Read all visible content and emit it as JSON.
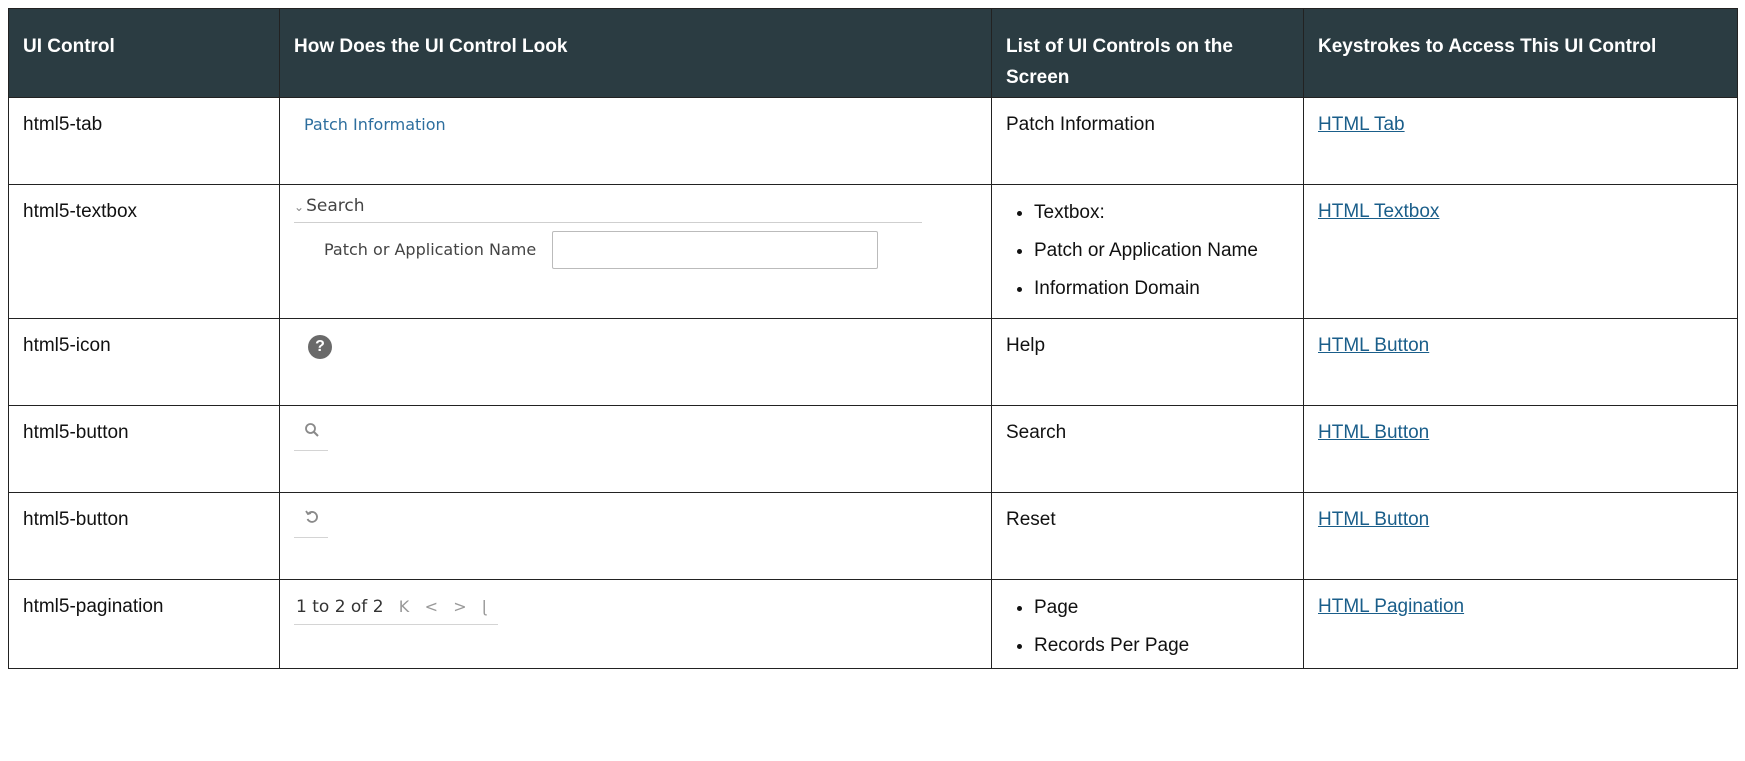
{
  "headers": {
    "ui_control": "UI Control",
    "how_look": "How Does the UI Control Look",
    "list_controls": "List of UI Controls on the Screen",
    "keystrokes": "Keystrokes to Access This UI Control"
  },
  "rows": [
    {
      "control": "html5-tab",
      "sample": "Patch Information",
      "list": [
        "Patch Information"
      ],
      "link": "HTML Tab"
    },
    {
      "control": "html5-textbox",
      "sample_title": "Search",
      "sample_label": "Patch or Application Name",
      "list": [
        "Textbox:",
        "Patch or Application Name",
        "Information Domain"
      ],
      "link": "HTML Textbox"
    },
    {
      "control": "html5-icon",
      "sample": "?",
      "list": [
        "Help"
      ],
      "link": "HTML Button"
    },
    {
      "control": "html5-button",
      "list": [
        "Search"
      ],
      "link": "HTML Button"
    },
    {
      "control": "html5-button",
      "list": [
        "Reset"
      ],
      "link": "HTML Button"
    },
    {
      "control": "html5-pagination",
      "sample": "1 to 2 of 2",
      "list": [
        "Page",
        "Records Per Page"
      ],
      "link": "HTML Pagination"
    }
  ],
  "icons": {
    "help": "help-icon",
    "search": "search-icon",
    "reset": "reset-icon",
    "pagination": [
      "first-page-icon",
      "previous-page-icon",
      "next-page-icon",
      "last-page-icon"
    ]
  },
  "colors": {
    "header_bg": "#2b3c42",
    "link": "#1a5e8a"
  }
}
